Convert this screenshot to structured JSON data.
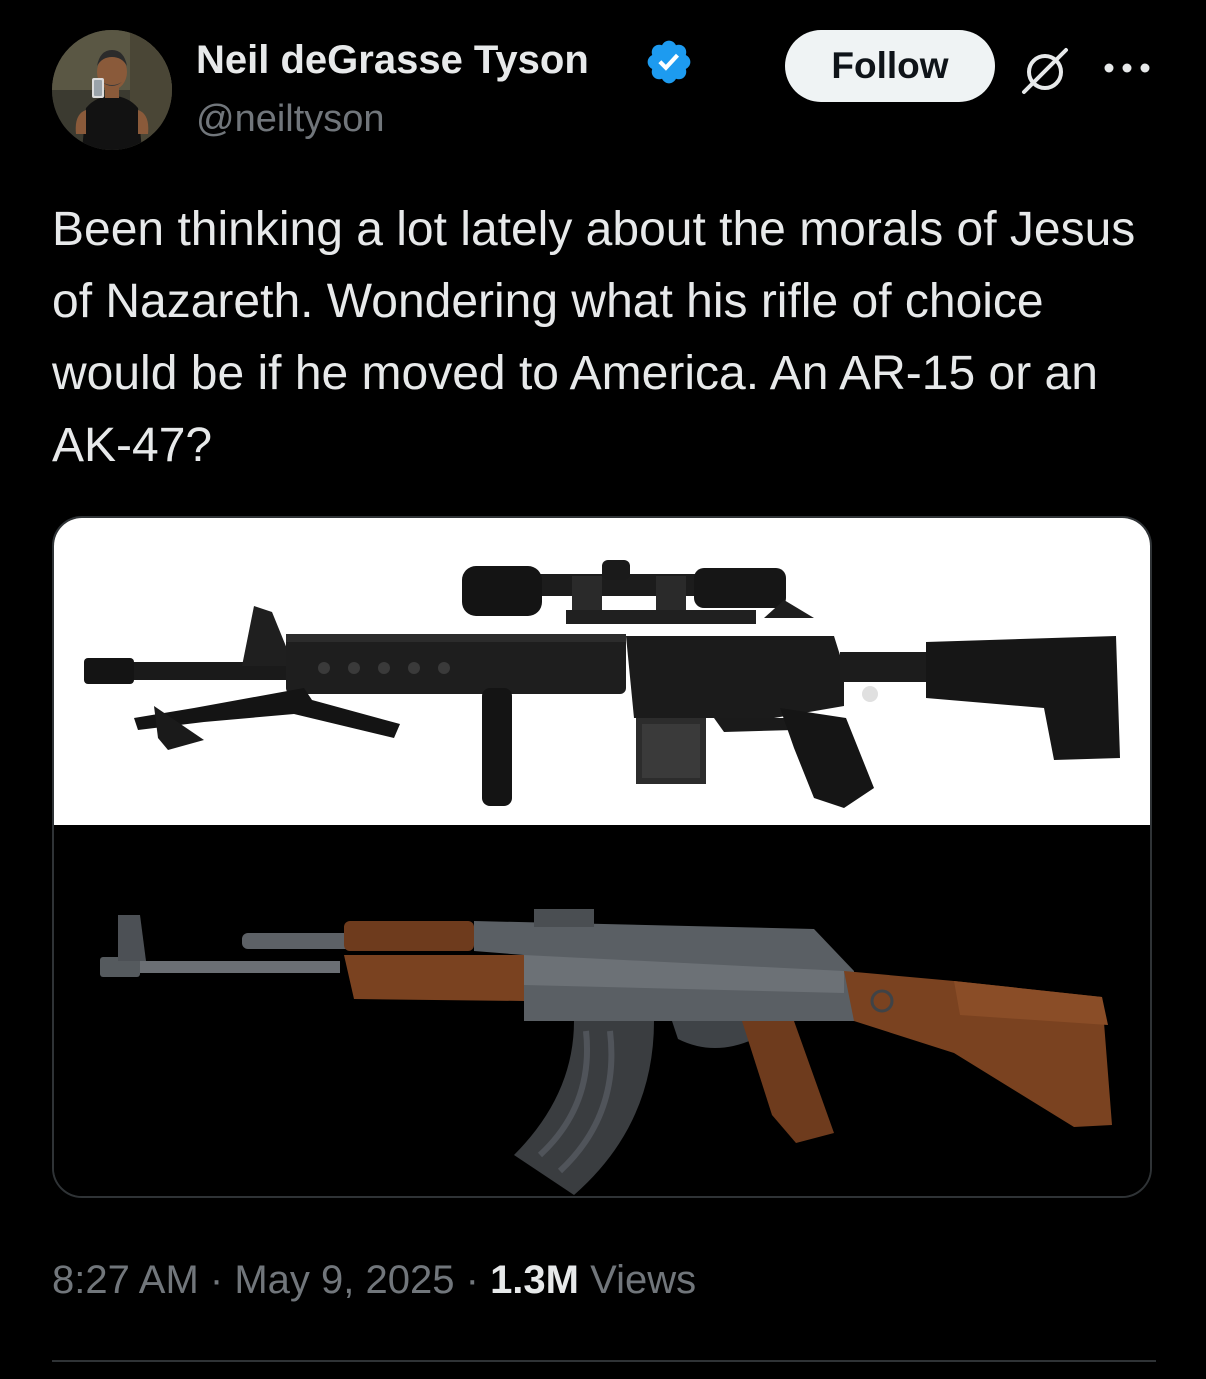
{
  "author": {
    "name": "Neil deGrasse Tyson",
    "handle": "@neiltyson",
    "verified": true,
    "verified_color": "#1d9bf0"
  },
  "header": {
    "follow_label": "Follow",
    "grok_icon": "grok-icon",
    "more_icon": "more-icon"
  },
  "tweet": {
    "text": "Been thinking a lot lately about the morals of Jesus of Nazareth. Wondering what his rifle of choice would be if he moved to America. An AR-15 or an AK-47?"
  },
  "meta": {
    "time": "8:27 AM",
    "separator": "·",
    "date": "May 9, 2025",
    "views_count": "1.3M",
    "views_label": "Views"
  },
  "colors": {
    "background": "#000000",
    "text_primary": "#e7e9ea",
    "text_secondary": "#71767b",
    "border": "#2f3336",
    "follow_bg": "#eff3f4"
  }
}
